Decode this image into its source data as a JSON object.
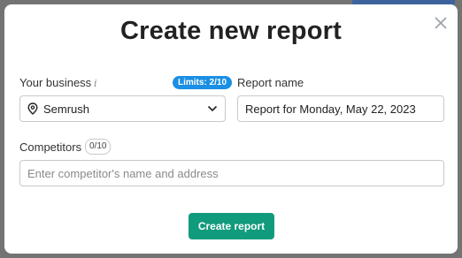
{
  "modal": {
    "title": "Create new report",
    "close_icon": "close-icon"
  },
  "business": {
    "label": "Your business",
    "info_icon": "info-icon",
    "info_glyph": "i",
    "limits_badge": "Limits: 2/10",
    "selected_value": "Semrush",
    "location_icon": "location-pin-icon",
    "dropdown_icon": "chevron-down-icon"
  },
  "report_name": {
    "label": "Report name",
    "value": "Report for Monday, May 22, 2023"
  },
  "competitors": {
    "label": "Competitors",
    "count_badge": "0/10",
    "placeholder": "Enter competitor's name and address"
  },
  "actions": {
    "create_label": "Create report"
  },
  "colors": {
    "primary_button": "#109b7c",
    "badge_blue": "#1a8fe3",
    "backdrop": "#737373"
  }
}
